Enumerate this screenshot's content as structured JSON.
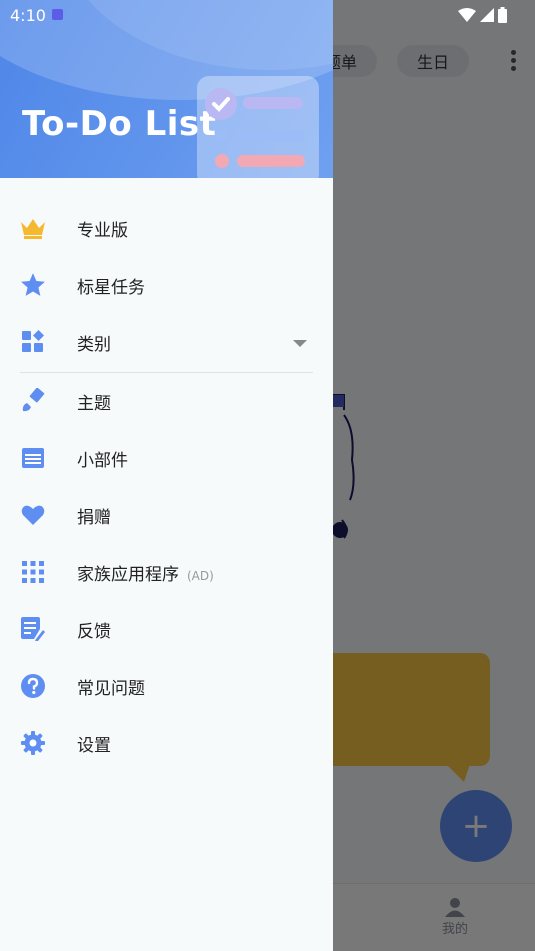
{
  "status": {
    "time": "4:10"
  },
  "background": {
    "chip_1": "题单",
    "chip_2": "生日",
    "fab": "+",
    "bottom_tab": "我的"
  },
  "drawer": {
    "title": "To-Do List",
    "items": [
      {
        "label": "专业版",
        "icon": "crown-icon",
        "color": "#f5b82e"
      },
      {
        "label": "标星任务",
        "icon": "star-icon",
        "color": "#5f8ef2"
      },
      {
        "label": "类别",
        "icon": "category-grid-icon",
        "color": "#5f8ef2",
        "expandable": true
      },
      {
        "label": "主题",
        "icon": "paint-brush-icon",
        "color": "#5f8ef2"
      },
      {
        "label": "小部件",
        "icon": "widget-icon",
        "color": "#5f8ef2"
      },
      {
        "label": "捐赠",
        "icon": "heart-icon",
        "color": "#5f8ef2"
      },
      {
        "label": "家族应用程序",
        "sub": "(AD)",
        "icon": "apps-grid-icon",
        "color": "#5f8ef2"
      },
      {
        "label": "反馈",
        "icon": "feedback-icon",
        "color": "#5f8ef2"
      },
      {
        "label": "常见问题",
        "icon": "help-icon",
        "color": "#5f8ef2"
      },
      {
        "label": "设置",
        "icon": "settings-gear-icon",
        "color": "#5f8ef2"
      }
    ]
  }
}
